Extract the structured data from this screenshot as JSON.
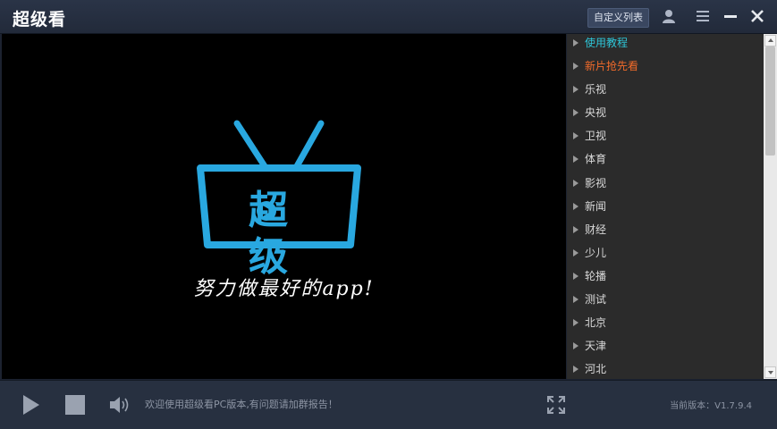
{
  "window": {
    "title": "超级看",
    "custom_list_label": "自定义列表",
    "icons": [
      "user-icon",
      "menu-icon",
      "minimize-icon",
      "close-icon"
    ]
  },
  "player": {
    "logo_text": "超级",
    "slogan": "努力做最好的app!"
  },
  "sidebar": {
    "items": [
      {
        "label": "使用教程",
        "color": "#2ec6d8"
      },
      {
        "label": "新片抢先看",
        "color": "#f26b2a"
      },
      {
        "label": "乐视",
        "color": "#d9d9d9"
      },
      {
        "label": "央视",
        "color": "#d9d9d9"
      },
      {
        "label": "卫视",
        "color": "#d9d9d9"
      },
      {
        "label": "体育",
        "color": "#d9d9d9"
      },
      {
        "label": "影视",
        "color": "#d9d9d9"
      },
      {
        "label": "新闻",
        "color": "#d9d9d9"
      },
      {
        "label": "财经",
        "color": "#d9d9d9"
      },
      {
        "label": "少儿",
        "color": "#d9d9d9"
      },
      {
        "label": "轮播",
        "color": "#d9d9d9"
      },
      {
        "label": "测试",
        "color": "#d9d9d9"
      },
      {
        "label": "北京",
        "color": "#d9d9d9"
      },
      {
        "label": "天津",
        "color": "#d9d9d9"
      },
      {
        "label": "河北",
        "color": "#d9d9d9"
      }
    ]
  },
  "controls": {
    "status": "欢迎使用超级看PC版本,有问题请加群报告！",
    "version": "当前版本：V1.7.9.4",
    "icons": [
      "play-icon",
      "stop-icon",
      "volume-icon",
      "fullscreen-icon"
    ]
  },
  "colors": {
    "accent_cyan": "#2ec6d8",
    "accent_orange": "#f26b2a",
    "logo_blue": "#29a8e0"
  }
}
